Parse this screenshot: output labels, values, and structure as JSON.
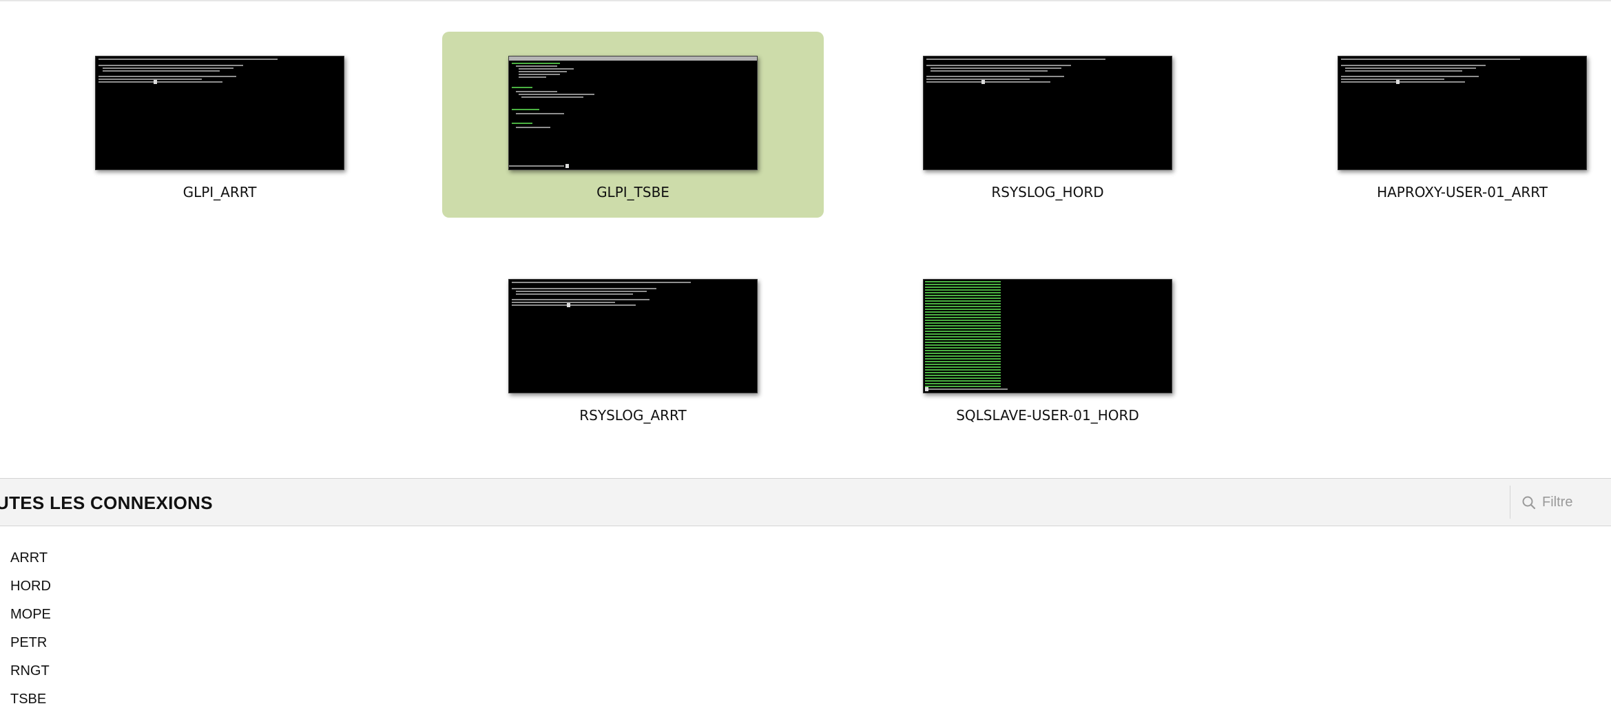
{
  "recent_connections": [
    {
      "name": "GLPI_ARRT",
      "active": false,
      "thumbnail": "terminal-shell"
    },
    {
      "name": "GLPI_TSBE",
      "active": true,
      "thumbnail": "terminal-editor"
    },
    {
      "name": "RSYSLOG_HORD",
      "active": false,
      "thumbnail": "terminal-shell"
    },
    {
      "name": "HAPROXY-USER-01_ARRT",
      "active": false,
      "thumbnail": "terminal-shell"
    },
    {
      "name": "RSYSLOG_ARRT",
      "active": false,
      "thumbnail": "terminal-shell"
    },
    {
      "name": "SQLSLAVE-USER-01_HORD",
      "active": false,
      "thumbnail": "terminal-green-log"
    }
  ],
  "all_connections": {
    "title": "UTES LES CONNEXIONS",
    "filter": {
      "placeholder": "Filtre",
      "value": "",
      "icon": "search-icon"
    },
    "groups": [
      {
        "label": "ARRT"
      },
      {
        "label": "HORD"
      },
      {
        "label": "MOPE"
      },
      {
        "label": "PETR"
      },
      {
        "label": "RNGT"
      },
      {
        "label": "TSBE"
      }
    ]
  },
  "colors": {
    "active_tile": "#cddcaa",
    "header_bg": "#f3f3f3",
    "terminal_bg": "#000000",
    "terminal_green": "#58d04e"
  }
}
